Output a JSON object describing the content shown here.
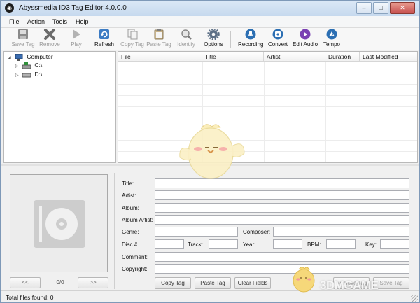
{
  "window": {
    "title": "Abyssmedia ID3 Tag Editor 4.0.0.0"
  },
  "window_controls": {
    "minimize": "–",
    "maximize": "□",
    "close": "✕"
  },
  "menu": [
    "File",
    "Action",
    "Tools",
    "Help"
  ],
  "toolbar": {
    "save_tag": "Save Tag",
    "remove": "Remove",
    "play": "Play",
    "refresh": "Refresh",
    "copy_tag": "Copy Tag",
    "paste_tag": "Paste Tag",
    "identify": "Identify",
    "options": "Options",
    "recording": "Recording",
    "convert": "Convert",
    "edit_audio": "Edit Audio",
    "tempo": "Tempo"
  },
  "tree": {
    "root": "Computer",
    "drives": [
      "C:\\",
      "D:\\"
    ]
  },
  "filelist": {
    "columns": [
      "File",
      "Title",
      "Artist",
      "Duration",
      "Last Modified"
    ]
  },
  "tag_form": {
    "title": "Title:",
    "artist": "Artist:",
    "album": "Album:",
    "album_artist": "Album Artist:",
    "genre": "Genre:",
    "composer": "Composer:",
    "disc": "Disc #",
    "track": "Track:",
    "year": "Year:",
    "bpm": "BPM:",
    "key": "Key:",
    "comment": "Comment:",
    "copyright": "Copyright:"
  },
  "artwork_nav": {
    "prev": "<<",
    "counter": "0/0",
    "next": ">>"
  },
  "actions": {
    "copy_tag": "Copy Tag",
    "paste_tag": "Paste Tag",
    "clear_fields": "Clear Fields",
    "remove_tag": "Remove Tag",
    "save_tag": "Save Tag"
  },
  "status": {
    "text": "Total files found: 0"
  },
  "watermark": {
    "text": "3DMGAME"
  },
  "colors": {
    "accent": "#3a6ea5",
    "record_red": "#c0392b",
    "convert_blue": "#2c6fb3"
  }
}
